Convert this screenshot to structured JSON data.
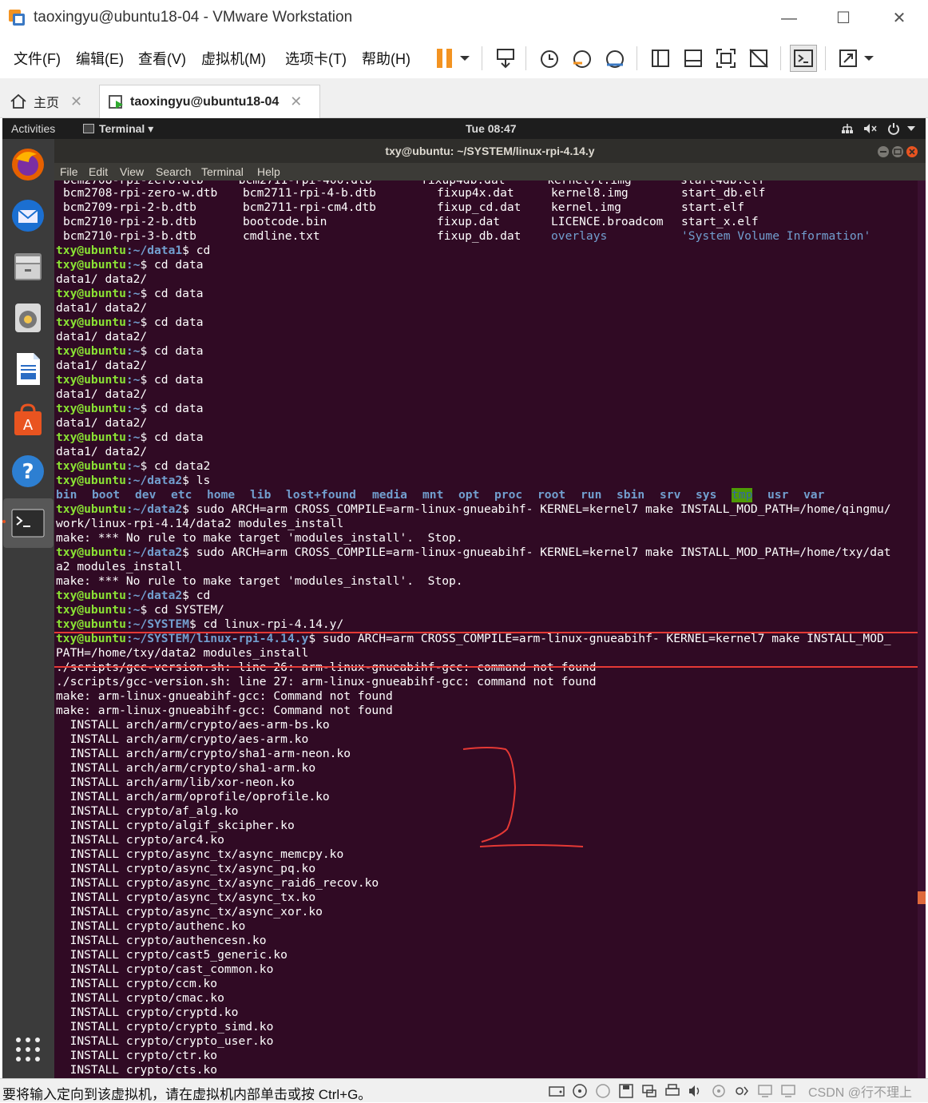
{
  "window": {
    "title": "taoxingyu@ubuntu18-04 - VMware Workstation",
    "minimize_glyph": "—",
    "maximize_glyph": "☐",
    "close_glyph": "✕"
  },
  "menu": {
    "file": "文件(F)",
    "edit": "编辑(E)",
    "view": "查看(V)",
    "vm": "虚拟机(M)",
    "tabs": "选项卡(T)",
    "help": "帮助(H)"
  },
  "tabs": [
    {
      "label": "主页",
      "close": "✕"
    },
    {
      "label": "taoxingyu@ubuntu18-04",
      "close": "✕"
    }
  ],
  "gnome": {
    "activities": "Activities",
    "app_menu": "Terminal ▾",
    "clock": "Tue 08:47"
  },
  "terminal": {
    "title": "txy@ubuntu: ~/SYSTEM/linux-rpi-4.14.y",
    "menu": [
      "File",
      "Edit",
      "View",
      "Search",
      "Terminal",
      "Help"
    ]
  },
  "listing": [
    [
      "bcm2708-rpi-zero-w.dtb",
      "bcm2711-rpi-4-b.dtb",
      "fixup4x.dat",
      "kernel8.img",
      "start_db.elf"
    ],
    [
      "bcm2709-rpi-2-b.dtb",
      "bcm2711-rpi-cm4.dtb",
      "fixup_cd.dat",
      "kernel.img",
      "start.elf"
    ],
    [
      "bcm2710-rpi-2-b.dtb",
      "bootcode.bin",
      "fixup.dat",
      "LICENCE.broadcom",
      "start_x.elf"
    ],
    [
      "bcm2710-rpi-3-b.dtb",
      "cmdline.txt",
      "fixup_db.dat",
      "overlays",
      "'System Volume Information'"
    ]
  ],
  "prompt_user": "txy@ubuntu",
  "paths": {
    "data1": ":~/data1",
    "home": ":~",
    "data2": ":~/data2",
    "system": ":~/SYSTEM",
    "linux": ":~/SYSTEM/linux-rpi-4.14.y"
  },
  "commands": {
    "cd": "$ cd",
    "cd_data": "$ cd data",
    "cd_data2": "$ cd data2",
    "ls": "$ ls",
    "cd_system": "$ cd SYSTEM/",
    "cd_linux": "$ cd linux-rpi-4.14.y/",
    "make1": "$ sudo ARCH=arm CROSS_COMPILE=arm-linux-gnueabihf- KERNEL=kernel7 make INSTALL_MOD_PATH=/home/qingmu/",
    "make1_cont": "work/linux-rpi-4.14/data2 modules_install",
    "make2": "$ sudo ARCH=arm CROSS_COMPILE=arm-linux-gnueabihf- KERNEL=kernel7 make INSTALL_MOD_PATH=/home/txy/dat",
    "make2_cont": "a2 modules_install",
    "make3": "$ sudo ARCH=arm CROSS_COMPILE=arm-linux-gnueabihf- KERNEL=kernel7 make INSTALL_MOD_",
    "make3_cont": "PATH=/home/txy/data2 modules_install"
  },
  "output": {
    "data_dirs": "data1/ data2/",
    "no_rule": "make: *** No rule to make target 'modules_install'.  Stop.",
    "gcc26": "./scripts/gcc-version.sh: line 26: arm-linux-gnueabihf-gcc: command not found",
    "gcc27": "./scripts/gcc-version.sh: line 27: arm-linux-gnueabihf-gcc: command not found",
    "make_cmd1": "make: arm-linux-gnueabihf-gcc: Command not found",
    "make_cmd2": "make: arm-linux-gnueabihf-gcc: Command not found"
  },
  "ls_dirs": [
    "bin",
    "boot",
    "dev",
    "etc",
    "home",
    "lib",
    "lost+found",
    "media",
    "mnt",
    "opt",
    "proc",
    "root",
    "run",
    "sbin",
    "srv",
    "sys",
    "tmp",
    "usr",
    "var"
  ],
  "install_prefix": "  INSTALL ",
  "installs": [
    "arch/arm/crypto/aes-arm-bs.ko",
    "arch/arm/crypto/aes-arm.ko",
    "arch/arm/crypto/sha1-arm-neon.ko",
    "arch/arm/crypto/sha1-arm.ko",
    "arch/arm/lib/xor-neon.ko",
    "arch/arm/oprofile/oprofile.ko",
    "crypto/af_alg.ko",
    "crypto/algif_skcipher.ko",
    "crypto/arc4.ko",
    "crypto/async_tx/async_memcpy.ko",
    "crypto/async_tx/async_pq.ko",
    "crypto/async_tx/async_raid6_recov.ko",
    "crypto/async_tx/async_tx.ko",
    "crypto/async_tx/async_xor.ko",
    "crypto/authenc.ko",
    "crypto/authencesn.ko",
    "crypto/cast5_generic.ko",
    "crypto/cast_common.ko",
    "crypto/ccm.ko",
    "crypto/cmac.ko",
    "crypto/cryptd.ko",
    "crypto/crypto_simd.ko",
    "crypto/crypto_user.ko",
    "crypto/ctr.ko",
    "crypto/cts.ko"
  ],
  "annotation": {
    "box_color": "#e53935",
    "mark_label": "2"
  },
  "status": {
    "hint": "要将输入定向到该虚拟机，请在虚拟机内部单击或按 Ctrl+G。",
    "watermark": "CSDN @行不理上"
  },
  "colors": {
    "terminal_bg": "#300a24",
    "prompt_green": "#8ae234",
    "dir_blue": "#729fcf",
    "pause_orange": "#f39321"
  }
}
